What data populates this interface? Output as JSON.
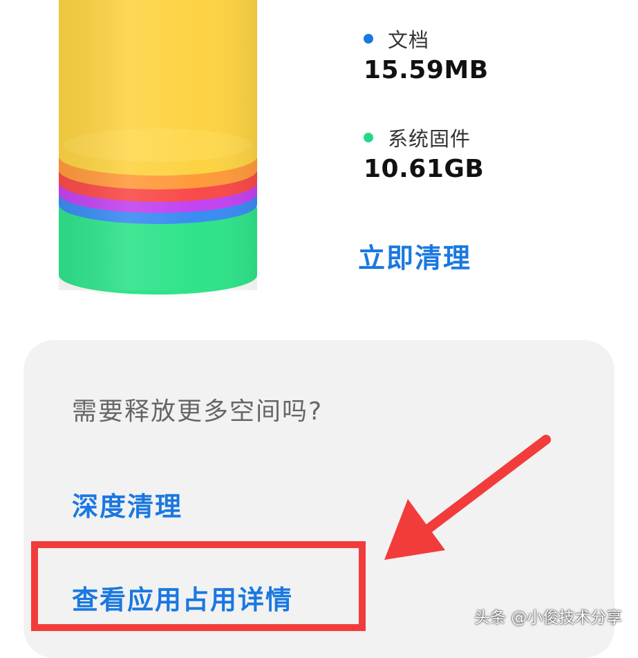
{
  "storage_chart": {
    "segments": [
      {
        "name": "yellow",
        "color": "#fdd343"
      },
      {
        "name": "orange",
        "color": "#ff9a3c"
      },
      {
        "name": "red",
        "color": "#f94a4a"
      },
      {
        "name": "purple",
        "color": "#c243f0"
      },
      {
        "name": "blue",
        "color": "#3a8cf2"
      },
      {
        "name": "green",
        "color": "#2fe38a"
      }
    ]
  },
  "legend": [
    {
      "label": "文档",
      "value": "15.59MB",
      "color": "#1a78e0"
    },
    {
      "label": "系统固件",
      "value": "10.61GB",
      "color": "#22d98a"
    }
  ],
  "actions": {
    "clean_now": "立即清理"
  },
  "panel": {
    "title": "需要释放更多空间吗?",
    "deep_clean": "深度清理",
    "view_app_usage": "查看应用占用详情"
  },
  "watermark": "头条 @小俊技术分享",
  "colors": {
    "accent": "#1a78e0",
    "annotation_red": "#f23c3c",
    "panel_bg": "#f2f2f2"
  }
}
